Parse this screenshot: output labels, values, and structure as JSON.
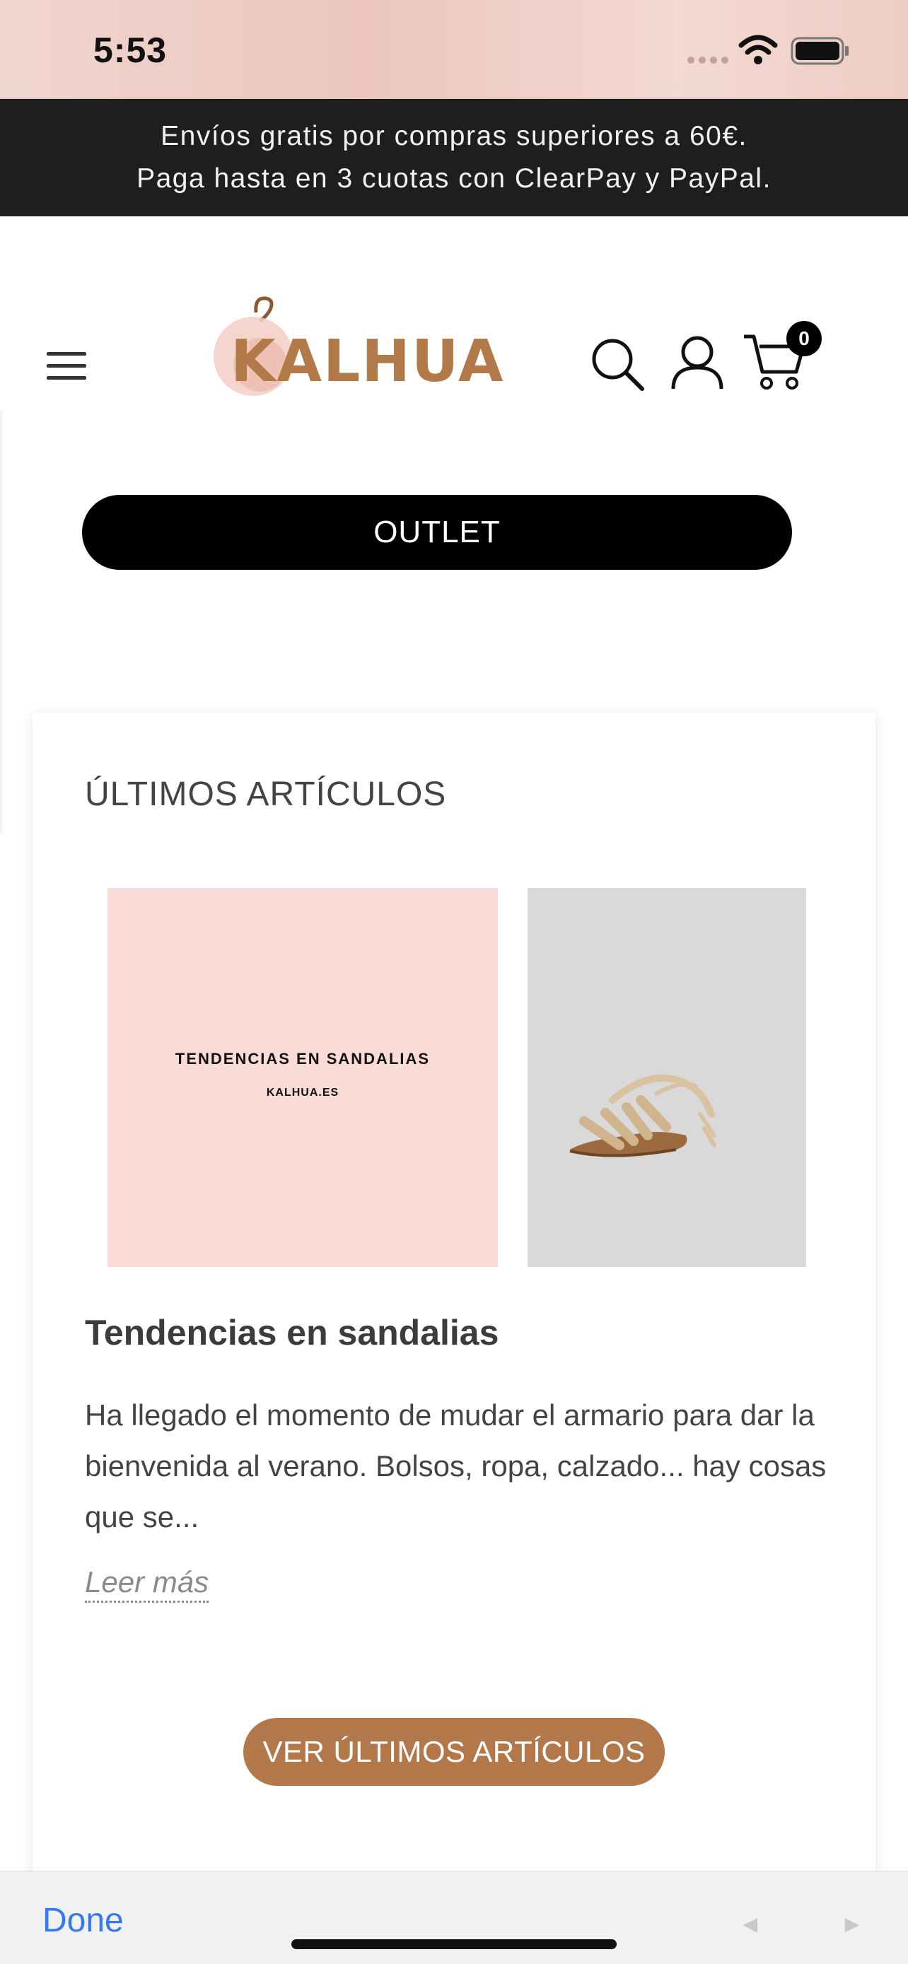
{
  "status_bar": {
    "time": "5:53"
  },
  "announcement": {
    "line1": "Envíos gratis por compras superiores a 60€.",
    "line2": "Paga hasta en 3 cuotas con ClearPay y PayPal."
  },
  "header": {
    "logo_text": "KALHUA",
    "cart_count": "0"
  },
  "outlet": {
    "label": "OUTLET"
  },
  "articles": {
    "section_title": "ÚLTIMOS ARTÍCULOS",
    "image_text_line1": "TENDENCIAS EN SANDALIAS",
    "image_text_line2": "KALHUA.ES",
    "title": "Tendencias en sandalias",
    "description": "Ha llegado el momento de mudar el armario para dar la bienvenida al verano. Bolsos, ropa, calzado... hay cosas que se...",
    "read_more": "Leer más",
    "view_all": "VER ÚLTIMOS ARTÍCULOS"
  },
  "toolbar": {
    "done": "Done",
    "prev": "◄",
    "next": "►"
  },
  "colors": {
    "brand": "#b2784a",
    "announcement_bg": "#1e1e1e",
    "link_blue": "#3478f6"
  }
}
